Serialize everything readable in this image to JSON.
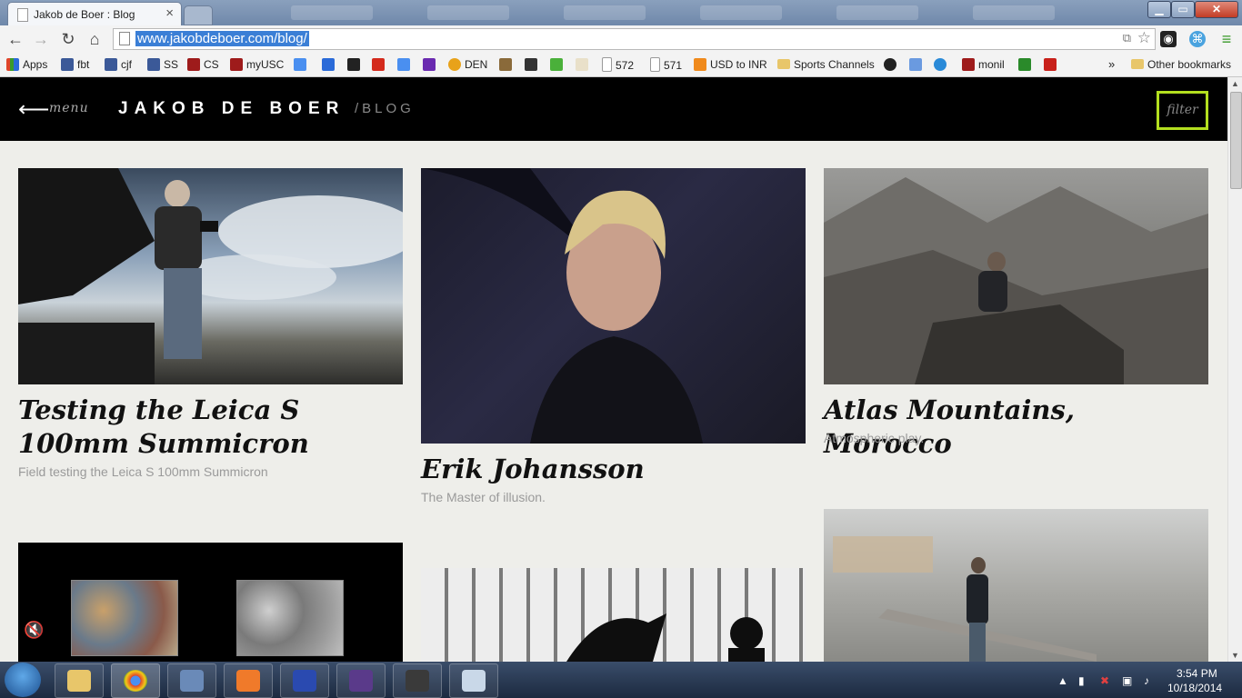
{
  "browser": {
    "tab_title": "Jakob de Boer : Blog",
    "tab_close": "×",
    "url": "www.jakobdeboer.com/blog/",
    "bookmarks": [
      {
        "label": "Apps",
        "color": "#e05a2a"
      },
      {
        "label": "fbt",
        "color": "#3b5998"
      },
      {
        "label": "cjf",
        "color": "#3b5998"
      },
      {
        "label": "SS",
        "color": "#3b5998"
      },
      {
        "label": "CS",
        "color": "#9e1b1b"
      },
      {
        "label": "myUSC",
        "color": "#9e1b1b"
      },
      {
        "label": "DEN",
        "color": "#e8a21a"
      },
      {
        "label": "572",
        "color": "#ffffff"
      },
      {
        "label": "571",
        "color": "#ffffff"
      },
      {
        "label": "USD to INR",
        "color": "#f08a1c"
      },
      {
        "label": "Sports Channels",
        "color": "#e8c66a"
      },
      {
        "label": "monil",
        "color": "#9e1b1b"
      }
    ],
    "bookmarks_overflow": "»",
    "other_bookmarks": "Other bookmarks"
  },
  "site": {
    "menu_label": "menu",
    "name": "JAKOB DE BOER",
    "section": "/BLOG",
    "filter_label": "filter",
    "accent_color": "#b3df1f"
  },
  "posts": [
    {
      "title": "Testing the Leica S 100mm Summicron",
      "subtitle": "Field testing the Leica S 100mm Summicron"
    },
    {
      "title": "Erik Johansson",
      "subtitle": "The Master of illusion."
    },
    {
      "title": "Atlas Mountains, Morocco",
      "subtitle": "Atmospheric play."
    }
  ],
  "taskbar": {
    "time": "3:54 PM",
    "date": "10/18/2014"
  }
}
